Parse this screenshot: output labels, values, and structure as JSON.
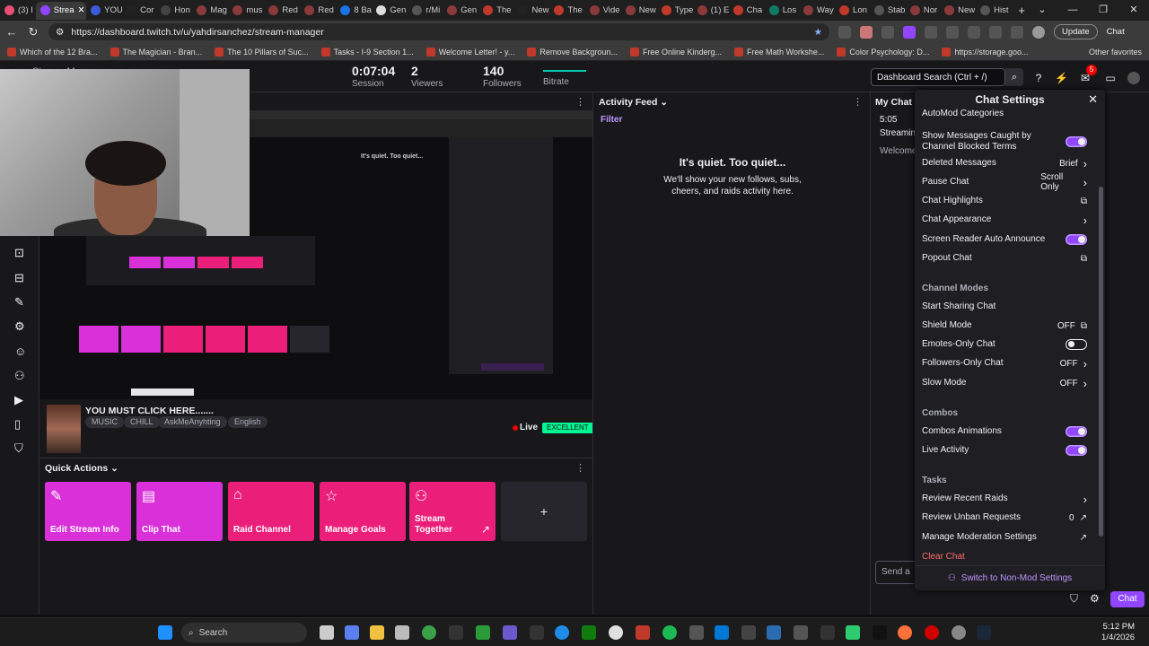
{
  "browser": {
    "tabs": [
      {
        "label": "(3) I",
        "color": "#e94e77"
      },
      {
        "label": "Strea",
        "color": "#9147ff",
        "active": true
      },
      {
        "label": "YOU",
        "color": "#3b5bdb"
      },
      {
        "label": "Cor",
        "color": "#222222"
      },
      {
        "label": "Hon",
        "color": "#444444"
      },
      {
        "label": "Mag",
        "color": "#8a3a3a"
      },
      {
        "label": "mus",
        "color": "#8a3a3a"
      },
      {
        "label": "Red",
        "color": "#8a3a3a"
      },
      {
        "label": "Red",
        "color": "#8a3a3a"
      },
      {
        "label": "8 Ba",
        "color": "#1a73e8"
      },
      {
        "label": "Gen",
        "color": "#dddddd"
      },
      {
        "label": "r/Mi",
        "color": "#555555"
      },
      {
        "label": "Gen",
        "color": "#8a3a3a"
      },
      {
        "label": "The",
        "color": "#c0392b"
      },
      {
        "label": "New",
        "color": "#222222"
      },
      {
        "label": "The",
        "color": "#c0392b"
      },
      {
        "label": "Vide",
        "color": "#8a3a3a"
      },
      {
        "label": "New",
        "color": "#8a3a3a"
      },
      {
        "label": "Type",
        "color": "#c0392b"
      },
      {
        "label": "(1) E",
        "color": "#8a3a3a"
      },
      {
        "label": "Cha",
        "color": "#c0392b"
      },
      {
        "label": "Los",
        "color": "#117a65"
      },
      {
        "label": "Way",
        "color": "#8a3a3a"
      },
      {
        "label": "Lon",
        "color": "#c0392b"
      },
      {
        "label": "Stab",
        "color": "#555555"
      },
      {
        "label": "Nor",
        "color": "#8a3a3a"
      },
      {
        "label": "New",
        "color": "#8a3a3a"
      },
      {
        "label": "Hist",
        "color": "#555555"
      }
    ],
    "new_tab": "+",
    "window_controls": [
      "⌄",
      "—",
      "❐",
      "✕"
    ],
    "url": "https://dashboard.twitch.tv/u/yahdirsanchez/stream-manager",
    "update_label": "Update",
    "chat_label": "Chat",
    "bookmarks": [
      "Which of the 12 Bra...",
      "The Magician - Bran...",
      "The 10 Pillars of Suc...",
      "Tasks - I-9 Section 1...",
      "Welcome Letter! - y...",
      "Remove Backgroun...",
      "Free Online Kinderg...",
      "Free Math Workshe...",
      "Color Psychology: D...",
      "https://storage.goo..."
    ],
    "other_favorites": "Other favorites"
  },
  "topbar": {
    "page_title": "Stream Manager",
    "session_value": "0:07:04",
    "session_label": "Session",
    "viewers_value": "2",
    "viewers_label": "Viewers",
    "followers_value": "140",
    "followers_label": "Followers",
    "bitrate_label": "Bitrate",
    "search_placeholder": "Dashboard Search (Ctrl + /)",
    "notification_count": "5"
  },
  "stream": {
    "title": "YOU MUST CLICK HERE.......",
    "tags": [
      "MUSIC",
      "CHILL",
      "AskMeAnyhting",
      "English"
    ],
    "live_label": "Live",
    "health_label": "EXCELLENT"
  },
  "quick_actions": {
    "title": "Quick Actions",
    "tiles": [
      {
        "label": "Edit Stream Info",
        "color": "#d930d9",
        "icon": "✎"
      },
      {
        "label": "Clip That",
        "color": "#d930d9",
        "icon": "▤"
      },
      {
        "label": "Raid Channel",
        "color": "#eb1f7a",
        "icon": "⌂"
      },
      {
        "label": "Manage Goals",
        "color": "#eb1f7a",
        "icon": "☆"
      },
      {
        "label": "Stream Together",
        "color": "#eb1f7a",
        "icon": "⚇"
      }
    ],
    "add_label": "+"
  },
  "activity_feed": {
    "title": "Activity Feed",
    "filter_label": "Filter",
    "empty_title": "It's quiet. Too quiet...",
    "empty_body": "We'll show your new follows, subs, cheers, and raids activity here."
  },
  "my_chat": {
    "title": "My Chat",
    "time": "5:05",
    "stream_text": "Streamin",
    "welcome_text": "Welcome",
    "send_placeholder": "Send a",
    "chat_button": "Chat"
  },
  "chat_settings": {
    "title": "Chat Settings",
    "top_cut": "AutoMod Categories",
    "rows": [
      {
        "label": "Show Messages Caught by Channel Blocked Terms",
        "value": "",
        "control": "toggle-on"
      },
      {
        "label": "Deleted Messages",
        "value": "Brief",
        "control": "chevron"
      },
      {
        "label": "Pause Chat",
        "value": "Scroll Only",
        "control": "chevron"
      },
      {
        "label": "Chat Highlights",
        "value": "",
        "control": "external"
      },
      {
        "label": "Chat Appearance",
        "value": "",
        "control": "chevron"
      },
      {
        "label": "Screen Reader Auto Announce",
        "value": "",
        "control": "toggle-on"
      },
      {
        "label": "Popout Chat",
        "value": "",
        "control": "external"
      }
    ],
    "channel_modes_header": "Channel Modes",
    "channel_modes": [
      {
        "label": "Start Sharing Chat",
        "value": "",
        "control": "none"
      },
      {
        "label": "Shield Mode",
        "value": "OFF",
        "control": "external"
      },
      {
        "label": "Emotes-Only Chat",
        "value": "",
        "control": "toggle-off"
      },
      {
        "label": "Followers-Only Chat",
        "value": "OFF",
        "control": "chevron"
      },
      {
        "label": "Slow Mode",
        "value": "OFF",
        "control": "chevron"
      }
    ],
    "combos_header": "Combos",
    "combos": [
      {
        "label": "Combos Animations",
        "value": "",
        "control": "toggle-on"
      },
      {
        "label": "Live Activity",
        "value": "",
        "control": "toggle-on"
      }
    ],
    "tasks_header": "Tasks",
    "tasks": [
      {
        "label": "Review Recent Raids",
        "value": "",
        "control": "chevron"
      },
      {
        "label": "Review Unban Requests",
        "value": "0",
        "control": "arrow"
      },
      {
        "label": "Manage Moderation Settings",
        "value": "",
        "control": "arrow"
      }
    ],
    "clear_chat": "Clear Chat",
    "switch_label": "Switch to Non-Mod Settings"
  },
  "taskbar": {
    "search_placeholder": "Search",
    "time": "5:12 PM",
    "date": "1/4/2026"
  }
}
